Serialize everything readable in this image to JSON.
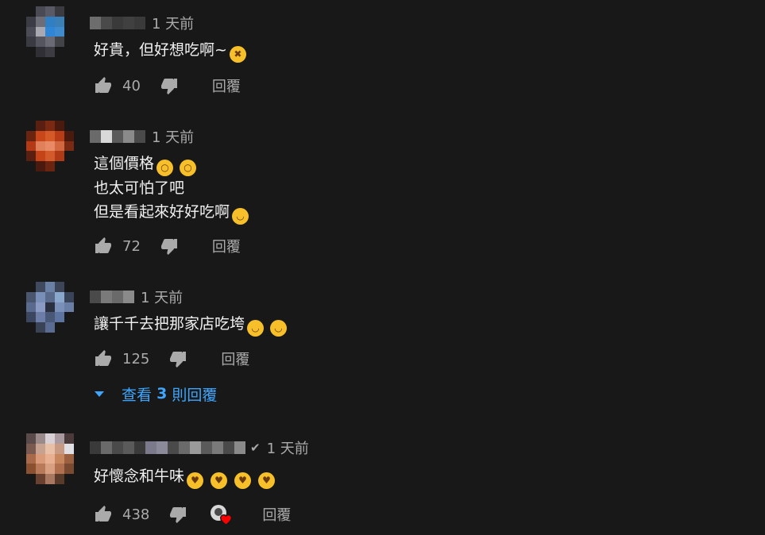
{
  "comments": [
    {
      "time": "1 天前",
      "text_lines": [
        "好貴，但好想吃啊~"
      ],
      "likes": "40",
      "reply_label": "回覆"
    },
    {
      "time": "1 天前",
      "text_lines": [
        "這個價格",
        "也太可怕了吧",
        "但是看起來好好吃啊"
      ],
      "likes": "72",
      "reply_label": "回覆"
    },
    {
      "time": "1 天前",
      "text_lines": [
        "讓千千去把那家店吃垮"
      ],
      "likes": "125",
      "reply_label": "回覆",
      "view_replies": {
        "prefix": "查看",
        "count": "3",
        "suffix": "則回覆"
      }
    },
    {
      "time": "1 天前",
      "text_lines": [
        "好懷念和牛味"
      ],
      "likes": "438",
      "reply_label": "回覆"
    }
  ],
  "icons": {
    "like": "thumbs-up-icon",
    "dislike": "thumbs-down-icon",
    "expand": "caret-down-icon",
    "verified": "checkmark-icon",
    "creator_heart": "heart-icon"
  },
  "colors": {
    "background": "#181818",
    "primary_text": "#f1f1f1",
    "secondary_text": "#aaaaaa",
    "link_blue": "#3ea6ff",
    "heart_red": "#ff0000"
  }
}
